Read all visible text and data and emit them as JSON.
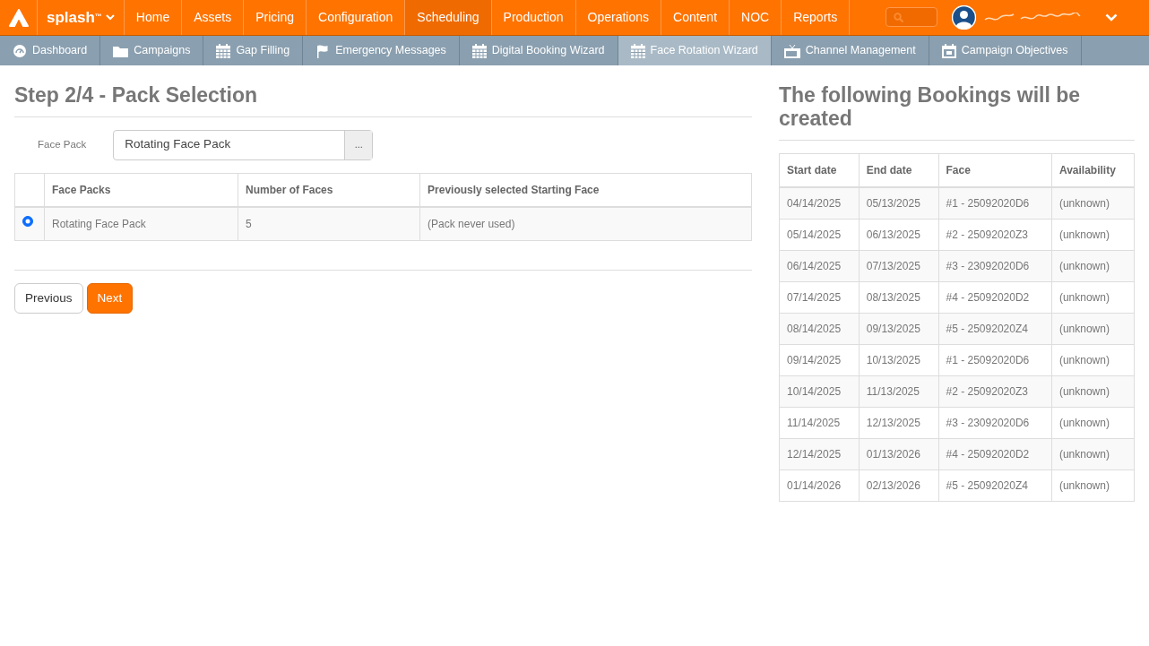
{
  "top_nav": {
    "brand": "splash",
    "brand_mark": "™",
    "items": [
      {
        "label": "Home",
        "selected": false
      },
      {
        "label": "Assets",
        "selected": false
      },
      {
        "label": "Pricing",
        "selected": false
      },
      {
        "label": "Configuration",
        "selected": false
      },
      {
        "label": "Scheduling",
        "selected": true
      },
      {
        "label": "Production",
        "selected": false
      },
      {
        "label": "Operations",
        "selected": false
      },
      {
        "label": "Content",
        "selected": false
      },
      {
        "label": "NOC",
        "selected": false
      },
      {
        "label": "Reports",
        "selected": false
      }
    ]
  },
  "sub_nav": [
    {
      "label": "Dashboard",
      "kind": "gauge",
      "selected": false
    },
    {
      "label": "Campaigns",
      "kind": "folder",
      "selected": false
    },
    {
      "label": "Gap Filling",
      "kind": "calendar",
      "selected": false
    },
    {
      "label": "Emergency Messages",
      "kind": "flag",
      "selected": false
    },
    {
      "label": "Digital Booking Wizard",
      "kind": "calendar",
      "selected": false
    },
    {
      "label": "Face Rotation Wizard",
      "kind": "calendar",
      "selected": true
    },
    {
      "label": "Channel Management",
      "kind": "tv",
      "selected": false
    },
    {
      "label": "Campaign Objectives",
      "kind": "calendar-day",
      "selected": false
    }
  ],
  "step": {
    "title": "Step 2/4 - Pack Selection",
    "field_label": "Face Pack",
    "field_value": "Rotating Face Pack",
    "browse_button": "...",
    "table": {
      "columns": [
        "Face Packs",
        "Number of Faces",
        "Previously selected Starting Face"
      ],
      "rows": [
        {
          "selected": true,
          "cells": [
            "Rotating Face Pack",
            "5",
            "(Pack never used)"
          ]
        }
      ]
    },
    "buttons": [
      {
        "label": "Previous",
        "kind": "secondary"
      },
      {
        "label": "Next",
        "kind": "primary"
      }
    ]
  },
  "bookings": {
    "title": "The following Bookings will be created",
    "columns": [
      "Start date",
      "End date",
      "Face",
      "Availability"
    ],
    "rows": [
      [
        "04/14/2025",
        "05/13/2025",
        "#1 - 25092020D6",
        "(unknown)"
      ],
      [
        "05/14/2025",
        "06/13/2025",
        "#2 - 25092020Z3",
        "(unknown)"
      ],
      [
        "06/14/2025",
        "07/13/2025",
        "#3 - 23092020D6",
        "(unknown)"
      ],
      [
        "07/14/2025",
        "08/13/2025",
        "#4 - 25092020D2",
        "(unknown)"
      ],
      [
        "08/14/2025",
        "09/13/2025",
        "#5 - 25092020Z4",
        "(unknown)"
      ],
      [
        "09/14/2025",
        "10/13/2025",
        "#1 - 25092020D6",
        "(unknown)"
      ],
      [
        "10/14/2025",
        "11/13/2025",
        "#2 - 25092020Z3",
        "(unknown)"
      ],
      [
        "11/14/2025",
        "12/13/2025",
        "#3 - 23092020D6",
        "(unknown)"
      ],
      [
        "12/14/2025",
        "01/13/2026",
        "#4 - 25092020D2",
        "(unknown)"
      ],
      [
        "01/14/2026",
        "02/13/2026",
        "#5 - 25092020Z4",
        "(unknown)"
      ]
    ]
  }
}
